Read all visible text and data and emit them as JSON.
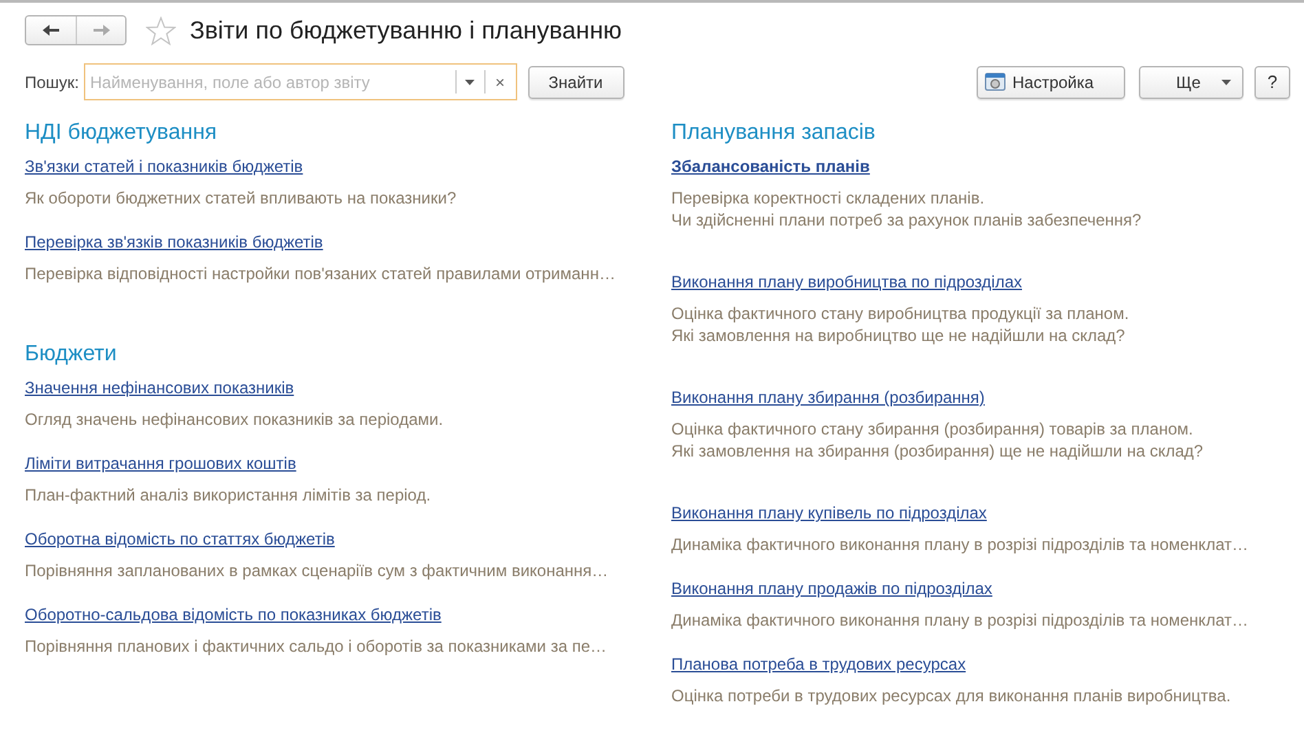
{
  "window": {
    "title": "Звіти по бюджетуванню і плануванню",
    "favorite": false
  },
  "search": {
    "label": "Пошук:",
    "placeholder": "Найменування, поле або автор звіту",
    "clear": "×",
    "find_button": "Знайти"
  },
  "toolbar": {
    "settings_button": "Настройка",
    "more_button": "Ще",
    "help_button": "?"
  },
  "columns": [
    {
      "sections": [
        {
          "title": "НДІ бюджетування",
          "reports": [
            {
              "title": "Зв'язки статей і показників бюджетів",
              "selected": false,
              "description": [
                "Як обороти бюджетних статей впливають на показники?"
              ]
            },
            {
              "title": "Перевірка зв'язків показників бюджетів",
              "selected": false,
              "description": [
                "Перевірка відповідності настройки пов'язаних статей правилами отриманн…"
              ]
            }
          ]
        },
        {
          "title": "Бюджети",
          "reports": [
            {
              "title": "Значення нефінансових показників",
              "selected": false,
              "description": [
                "Огляд значень нефінансових показників за періодами."
              ]
            },
            {
              "title": "Ліміти витрачання грошових коштів",
              "selected": false,
              "description": [
                "План-фактний аналіз використання лімітів за період."
              ]
            },
            {
              "title": "Оборотна відомість по статтях бюджетів",
              "selected": false,
              "description": [
                "Порівняння запланованих в рамках сценаріїв сум з фактичним виконання…"
              ]
            },
            {
              "title": "Оборотно-сальдова відомість по показниках бюджетів",
              "selected": false,
              "description": [
                "Порівняння планових і фактичних сальдо і оборотів за показниками за пе…"
              ]
            }
          ]
        }
      ]
    },
    {
      "sections": [
        {
          "title": "Планування запасів",
          "reports": [
            {
              "title": "Збалансованість планів",
              "selected": true,
              "description": [
                "Перевірка коректності складених планів.",
                "Чи здійсненні плани потреб за рахунок планів забезпечення?"
              ]
            },
            {
              "title": "Виконання плану виробництва по підрозділах",
              "selected": false,
              "description": [
                "Оцінка фактичного стану виробництва продукції за планом.",
                "Які замовлення на виробництво ще не надійшли на склад?"
              ]
            },
            {
              "title": "Виконання плану збирання (розбирання)",
              "selected": false,
              "description": [
                "Оцінка фактичного стану збирання (розбирання) товарів за планом.",
                "Які замовлення на збирання (розбирання) ще не надійшли на склад?"
              ]
            },
            {
              "title": "Виконання плану купівель по підрозділах",
              "selected": false,
              "description": [
                "Динаміка фактичного виконання плану в розрізі підрозділів та номенклат…"
              ]
            },
            {
              "title": "Виконання плану продажів по підрозділах",
              "selected": false,
              "description": [
                "Динаміка фактичного виконання плану в розрізі підрозділів та номенклат…"
              ]
            },
            {
              "title": "Планова потреба в трудових ресурсах",
              "selected": false,
              "description": [
                "Оцінка потреби в трудових ресурсах для виконання планів виробництва."
              ]
            }
          ]
        }
      ]
    }
  ]
}
